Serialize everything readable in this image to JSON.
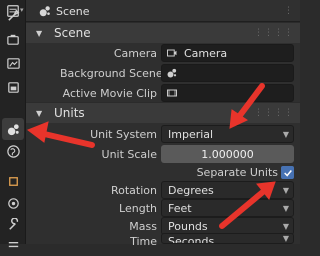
{
  "header": {
    "title": "Scene"
  },
  "scene_panel": {
    "title": "Scene",
    "camera_label": "Camera",
    "camera_value": "Camera",
    "background_scene_label": "Background Scene",
    "active_clip_label": "Active Movie Clip"
  },
  "units_panel": {
    "title": "Units",
    "unit_system_label": "Unit System",
    "unit_system_value": "Imperial",
    "unit_scale_label": "Unit Scale",
    "unit_scale_value": "1.000000",
    "separate_units_label": "Separate Units",
    "separate_units_checked": true,
    "rotation_label": "Rotation",
    "rotation_value": "Degrees",
    "length_label": "Length",
    "length_value": "Feet",
    "mass_label": "Mass",
    "mass_value": "Pounds",
    "time_label": "Time",
    "time_value": "Seconds"
  },
  "colors": {
    "accent": "#4772b3",
    "annotation_arrow": "#e8342b"
  }
}
